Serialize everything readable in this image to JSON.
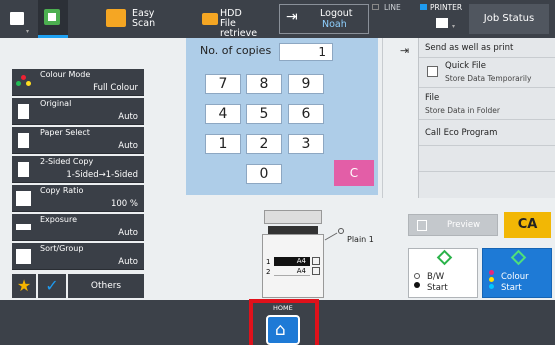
{
  "topbar": {
    "easy_scan": [
      "Easy",
      "Scan"
    ],
    "hdd": [
      "HDD",
      "File retrieve"
    ],
    "logout": [
      "Logout",
      "Noah"
    ],
    "line": "LINE",
    "printer": "PRINTER",
    "job_status": "Job Status"
  },
  "settings": [
    {
      "label": "Colour Mode",
      "value": "Full Colour"
    },
    {
      "label": "Original",
      "value": "Auto"
    },
    {
      "label": "Paper Select",
      "value": "Auto"
    },
    {
      "label": "2-Sided Copy",
      "value": "1-Sided→1-Sided"
    },
    {
      "label": "Copy Ratio",
      "value": "100 %"
    },
    {
      "label": "Exposure",
      "value": "Auto"
    },
    {
      "label": "Sort/Group",
      "value": "Auto"
    }
  ],
  "others_label": "Others",
  "copies": {
    "label": "No. of copies",
    "value": "1",
    "keys": [
      "7",
      "8",
      "9",
      "4",
      "5",
      "6",
      "1",
      "2",
      "3",
      "0"
    ],
    "clear": "C"
  },
  "right": {
    "send_print": "Send as well as print",
    "quick_file": "Quick File",
    "quick_file_sub": "Store Data Temporarily",
    "file": "File",
    "file_sub": "Store Data in Folder",
    "eco": "Call Eco Program"
  },
  "machine": {
    "tray_label": "Plain 1",
    "tray1_num": "1",
    "tray1_size": "A4",
    "tray2_num": "2",
    "tray2_size": "A4"
  },
  "actions": {
    "preview": "Preview",
    "ca": "CA",
    "bw": [
      "B/W",
      "Start"
    ],
    "colour": [
      "Colour",
      "Start"
    ]
  },
  "home_label": "HOME",
  "colors": {
    "dark": "#3c4149",
    "accent_blue": "#1e7ad6",
    "ca_yellow": "#f2b705",
    "clear_pink": "#e35ea7",
    "highlight_red": "#e0111b"
  }
}
